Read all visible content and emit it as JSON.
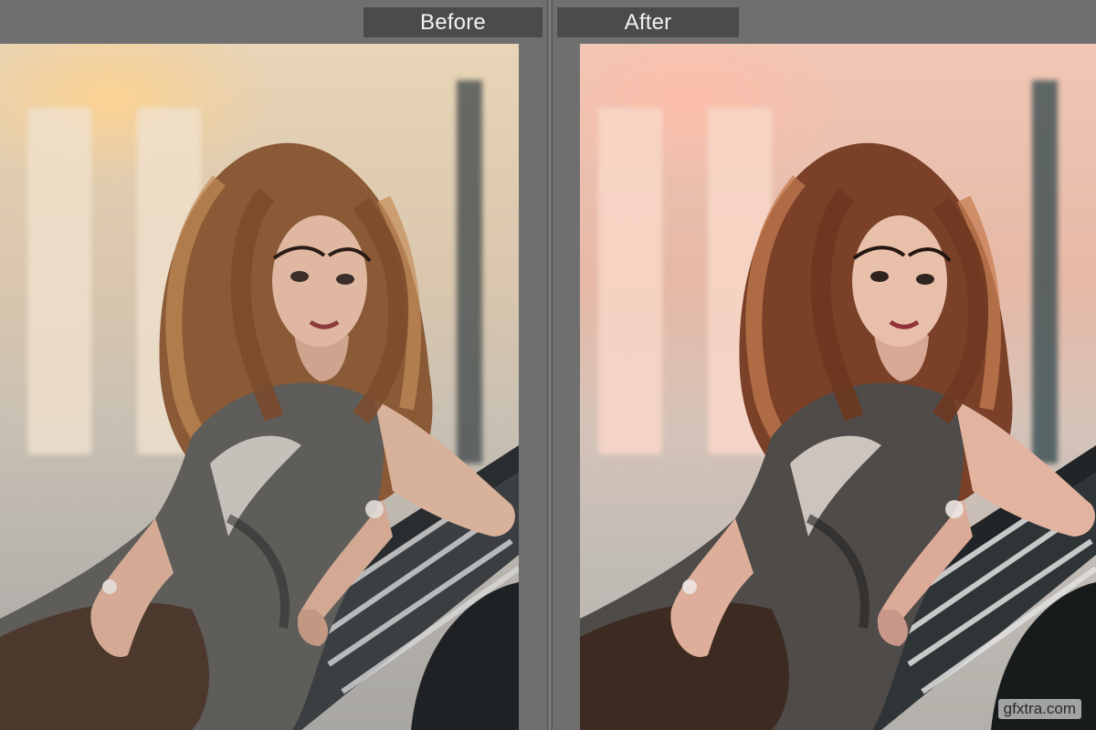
{
  "compare": {
    "before_label": "Before",
    "after_label": "After"
  },
  "watermark": {
    "text": "gfxtra.com"
  },
  "colors": {
    "panel_bg": "#707070",
    "label_bg": "#4b4b4b",
    "label_text": "#f2f2f2"
  }
}
